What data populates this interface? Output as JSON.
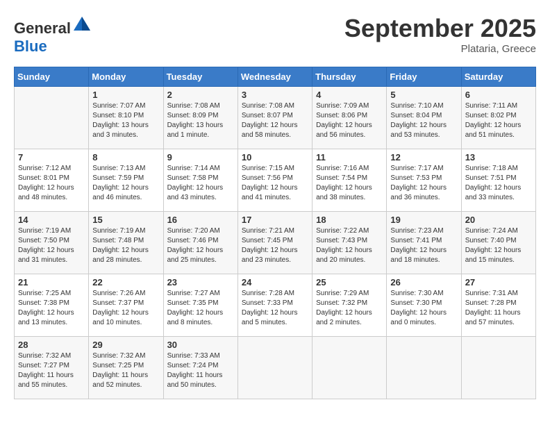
{
  "header": {
    "logo_general": "General",
    "logo_blue": "Blue",
    "month": "September 2025",
    "location": "Plataria, Greece"
  },
  "days_of_week": [
    "Sunday",
    "Monday",
    "Tuesday",
    "Wednesday",
    "Thursday",
    "Friday",
    "Saturday"
  ],
  "weeks": [
    [
      {
        "day": "",
        "info": ""
      },
      {
        "day": "1",
        "info": "Sunrise: 7:07 AM\nSunset: 8:10 PM\nDaylight: 13 hours\nand 3 minutes."
      },
      {
        "day": "2",
        "info": "Sunrise: 7:08 AM\nSunset: 8:09 PM\nDaylight: 13 hours\nand 1 minute."
      },
      {
        "day": "3",
        "info": "Sunrise: 7:08 AM\nSunset: 8:07 PM\nDaylight: 12 hours\nand 58 minutes."
      },
      {
        "day": "4",
        "info": "Sunrise: 7:09 AM\nSunset: 8:06 PM\nDaylight: 12 hours\nand 56 minutes."
      },
      {
        "day": "5",
        "info": "Sunrise: 7:10 AM\nSunset: 8:04 PM\nDaylight: 12 hours\nand 53 minutes."
      },
      {
        "day": "6",
        "info": "Sunrise: 7:11 AM\nSunset: 8:02 PM\nDaylight: 12 hours\nand 51 minutes."
      }
    ],
    [
      {
        "day": "7",
        "info": "Sunrise: 7:12 AM\nSunset: 8:01 PM\nDaylight: 12 hours\nand 48 minutes."
      },
      {
        "day": "8",
        "info": "Sunrise: 7:13 AM\nSunset: 7:59 PM\nDaylight: 12 hours\nand 46 minutes."
      },
      {
        "day": "9",
        "info": "Sunrise: 7:14 AM\nSunset: 7:58 PM\nDaylight: 12 hours\nand 43 minutes."
      },
      {
        "day": "10",
        "info": "Sunrise: 7:15 AM\nSunset: 7:56 PM\nDaylight: 12 hours\nand 41 minutes."
      },
      {
        "day": "11",
        "info": "Sunrise: 7:16 AM\nSunset: 7:54 PM\nDaylight: 12 hours\nand 38 minutes."
      },
      {
        "day": "12",
        "info": "Sunrise: 7:17 AM\nSunset: 7:53 PM\nDaylight: 12 hours\nand 36 minutes."
      },
      {
        "day": "13",
        "info": "Sunrise: 7:18 AM\nSunset: 7:51 PM\nDaylight: 12 hours\nand 33 minutes."
      }
    ],
    [
      {
        "day": "14",
        "info": "Sunrise: 7:19 AM\nSunset: 7:50 PM\nDaylight: 12 hours\nand 31 minutes."
      },
      {
        "day": "15",
        "info": "Sunrise: 7:19 AM\nSunset: 7:48 PM\nDaylight: 12 hours\nand 28 minutes."
      },
      {
        "day": "16",
        "info": "Sunrise: 7:20 AM\nSunset: 7:46 PM\nDaylight: 12 hours\nand 25 minutes."
      },
      {
        "day": "17",
        "info": "Sunrise: 7:21 AM\nSunset: 7:45 PM\nDaylight: 12 hours\nand 23 minutes."
      },
      {
        "day": "18",
        "info": "Sunrise: 7:22 AM\nSunset: 7:43 PM\nDaylight: 12 hours\nand 20 minutes."
      },
      {
        "day": "19",
        "info": "Sunrise: 7:23 AM\nSunset: 7:41 PM\nDaylight: 12 hours\nand 18 minutes."
      },
      {
        "day": "20",
        "info": "Sunrise: 7:24 AM\nSunset: 7:40 PM\nDaylight: 12 hours\nand 15 minutes."
      }
    ],
    [
      {
        "day": "21",
        "info": "Sunrise: 7:25 AM\nSunset: 7:38 PM\nDaylight: 12 hours\nand 13 minutes."
      },
      {
        "day": "22",
        "info": "Sunrise: 7:26 AM\nSunset: 7:37 PM\nDaylight: 12 hours\nand 10 minutes."
      },
      {
        "day": "23",
        "info": "Sunrise: 7:27 AM\nSunset: 7:35 PM\nDaylight: 12 hours\nand 8 minutes."
      },
      {
        "day": "24",
        "info": "Sunrise: 7:28 AM\nSunset: 7:33 PM\nDaylight: 12 hours\nand 5 minutes."
      },
      {
        "day": "25",
        "info": "Sunrise: 7:29 AM\nSunset: 7:32 PM\nDaylight: 12 hours\nand 2 minutes."
      },
      {
        "day": "26",
        "info": "Sunrise: 7:30 AM\nSunset: 7:30 PM\nDaylight: 12 hours\nand 0 minutes."
      },
      {
        "day": "27",
        "info": "Sunrise: 7:31 AM\nSunset: 7:28 PM\nDaylight: 11 hours\nand 57 minutes."
      }
    ],
    [
      {
        "day": "28",
        "info": "Sunrise: 7:32 AM\nSunset: 7:27 PM\nDaylight: 11 hours\nand 55 minutes."
      },
      {
        "day": "29",
        "info": "Sunrise: 7:32 AM\nSunset: 7:25 PM\nDaylight: 11 hours\nand 52 minutes."
      },
      {
        "day": "30",
        "info": "Sunrise: 7:33 AM\nSunset: 7:24 PM\nDaylight: 11 hours\nand 50 minutes."
      },
      {
        "day": "",
        "info": ""
      },
      {
        "day": "",
        "info": ""
      },
      {
        "day": "",
        "info": ""
      },
      {
        "day": "",
        "info": ""
      }
    ]
  ]
}
